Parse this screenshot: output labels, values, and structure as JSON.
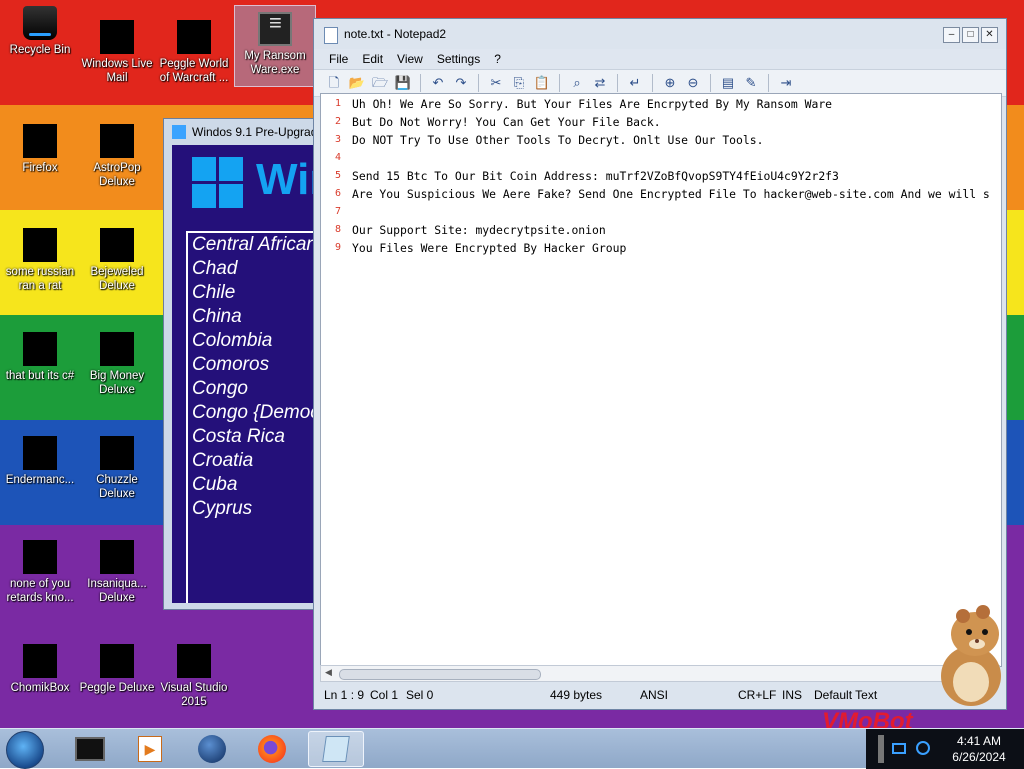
{
  "desktop_icons": [
    {
      "label": "Recycle Bin"
    },
    {
      "label": "Windows Live Mail"
    },
    {
      "label": "Peggle World of Warcraft ..."
    },
    {
      "label": "My Ransom Ware.exe"
    },
    {
      "label": "Firefox"
    },
    {
      "label": "AstroPop Deluxe"
    },
    {
      "label": "some russian ran a rat"
    },
    {
      "label": "Bejeweled Deluxe"
    },
    {
      "label": "that but its c#"
    },
    {
      "label": "Big Money Deluxe"
    },
    {
      "label": "Endermanc..."
    },
    {
      "label": "Chuzzle Deluxe"
    },
    {
      "label": "none of you retards kno..."
    },
    {
      "label": "Insaniqua... Deluxe"
    },
    {
      "label": "ChomikBox"
    },
    {
      "label": "Peggle Deluxe"
    },
    {
      "label": "Visual Studio 2015"
    }
  ],
  "bg_window": {
    "title": "Windos 9.1 Pre-Upgrad",
    "logo_text": "Wir",
    "countries": [
      "Central African",
      "Chad",
      "Chile",
      "China",
      "Colombia",
      "Comoros",
      "Congo",
      "Congo {Democ",
      "Costa Rica",
      "Croatia",
      "Cuba",
      "Cyprus"
    ]
  },
  "notepad": {
    "title": "note.txt - Notepad2",
    "menu": [
      "File",
      "Edit",
      "View",
      "Settings",
      "?"
    ],
    "lines": [
      "Uh Oh! We Are So Sorry. But Your Files Are Encrpyted By My Ransom Ware",
      "But Do Not Worry! You Can Get Your File Back.",
      "Do NOT Try To Use Other Tools To Decryt. Onlt Use Our Tools.",
      "",
      "Send 15 Btc To Our Bit Coin Address: muTrf2VZoBfQvopS9TY4fEioU4c9Y2r2f3",
      "Are You Suspicious We Aere Fake? Send One Encrypted File To hacker@web-site.com And we will s",
      "",
      "Our Support Site: mydecrytpsite.onion",
      "You Files Were Encrypted By Hacker Group"
    ],
    "line_numbers": [
      "1",
      "2",
      "3",
      "4",
      "5",
      "6",
      "7",
      "8",
      "9"
    ],
    "status": {
      "position": "Ln 1 : 9",
      "col": "Col 1",
      "sel": "Sel 0",
      "size": "449 bytes",
      "encoding": "ANSI",
      "eol": "CR+LF",
      "mode": "INS",
      "scheme": "Default Text"
    }
  },
  "watermark": "VMoBot",
  "clock": {
    "time": "4:41 AM",
    "date": "6/26/2024"
  },
  "colors": {
    "accent": "#14a3f2",
    "line_number": "#d93b2b"
  }
}
